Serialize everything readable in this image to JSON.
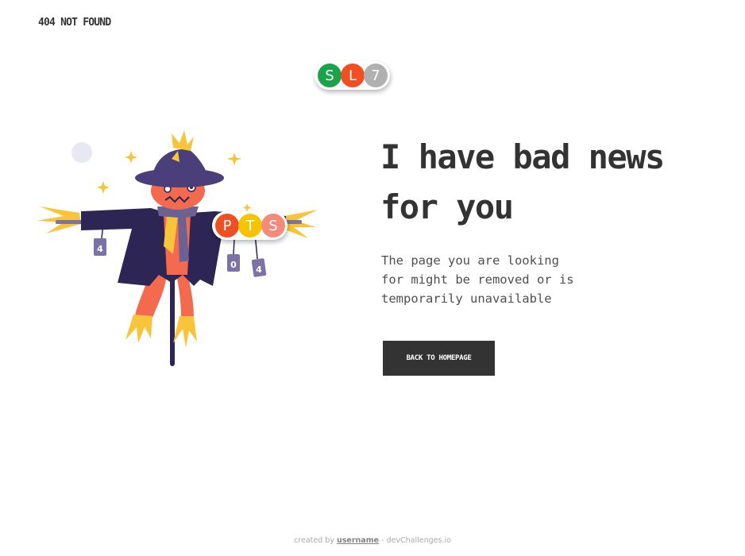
{
  "header": {
    "brand": "404 NOT FOUND"
  },
  "badges_top": [
    {
      "letter": "S",
      "color": "#1aa34a"
    },
    {
      "letter": "L",
      "color": "#f04e23"
    },
    {
      "letter": "7",
      "color": "#b0b0b0"
    }
  ],
  "badges_mid": [
    {
      "letter": "P",
      "color": "#f04e23"
    },
    {
      "letter": "T",
      "color": "#f5c400"
    },
    {
      "letter": "S",
      "color": "#f58a7a"
    }
  ],
  "illustration": {
    "can_left": "4",
    "can_right_1": "0",
    "can_right_2": "4"
  },
  "main": {
    "headline": "I have bad news for you",
    "description": "The page you are looking for might be removed or is temporarily unavailable",
    "button_label": "BACK TO HOMEPAGE"
  },
  "footer": {
    "prefix": "created by ",
    "username": "username",
    "suffix": " - devChallenges.io"
  },
  "colors": {
    "text_dark": "#333333",
    "button_bg": "#333333",
    "scarecrow_hat": "#4a3f7a",
    "scarecrow_coat": "#2d2553",
    "scarecrow_body": "#f46a4e",
    "straw": "#f8c53a"
  }
}
